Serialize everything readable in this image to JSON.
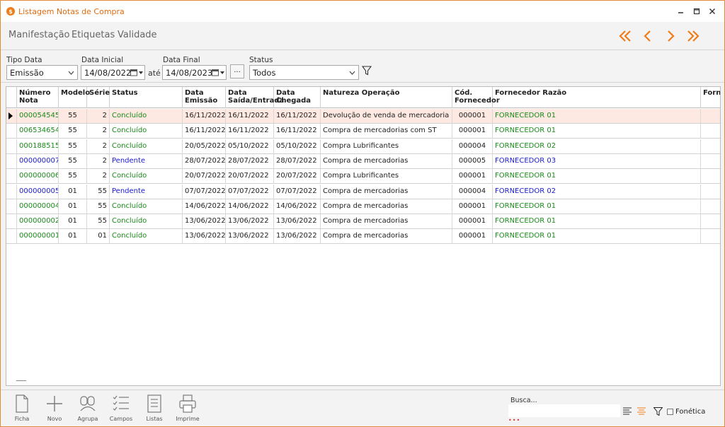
{
  "window": {
    "title": "Listagem Notas de Compra"
  },
  "menu": [
    "Manifestação",
    "Etiquetas",
    "Validade"
  ],
  "filters": {
    "tipo_data_label": "Tipo Data",
    "tipo_data_value": "Emissão",
    "data_inicial_label": "Data Inicial",
    "data_inicial_value": "14/08/2022",
    "ate_label": "até",
    "data_final_label": "Data Final",
    "data_final_value": "14/08/2023",
    "dots_label": "...",
    "status_label": "Status",
    "status_value": "Todos"
  },
  "grid": {
    "headers": [
      "Número Nota",
      "Modelo",
      "Série",
      "Status",
      "Data Emissão",
      "Data Saída/Entrada",
      "Data Chegada",
      "Natureza Operação",
      "Cód. Fornecedor",
      "Fornecedor Razão",
      "Forne"
    ],
    "rows": [
      {
        "numero": "000054545",
        "modelo": "55",
        "serie": "2",
        "status": "Concluído",
        "emissao": "16/11/2022",
        "saida": "16/11/2022",
        "chegada": "16/11/2022",
        "natureza": "Devolução de venda de mercadoria",
        "cod": "000001",
        "razao": "FORNECEDOR 01",
        "color": "green",
        "selected": true
      },
      {
        "numero": "006534654",
        "modelo": "55",
        "serie": "2",
        "status": "Concluído",
        "emissao": "16/11/2022",
        "saida": "16/11/2022",
        "chegada": "16/11/2022",
        "natureza": "Compra de mercadorias com ST",
        "cod": "000001",
        "razao": "FORNECEDOR 01",
        "color": "green"
      },
      {
        "numero": "000188515",
        "modelo": "55",
        "serie": "2",
        "status": "Concluído",
        "emissao": "20/05/2022",
        "saida": "05/10/2022",
        "chegada": "05/10/2022",
        "natureza": "Compra Lubrificantes",
        "cod": "000004",
        "razao": "FORNECEDOR 02",
        "color": "green"
      },
      {
        "numero": "000000007",
        "modelo": "55",
        "serie": "2",
        "status": "Pendente",
        "emissao": "28/07/2022",
        "saida": "28/07/2022",
        "chegada": "28/07/2022",
        "natureza": "Compra de mercadorias",
        "cod": "000005",
        "razao": "FORNECEDOR 03",
        "color": "blue"
      },
      {
        "numero": "000000006",
        "modelo": "55",
        "serie": "2",
        "status": "Concluído",
        "emissao": "20/07/2022",
        "saida": "20/07/2022",
        "chegada": "20/07/2022",
        "natureza": "Compra Lubrificantes",
        "cod": "000001",
        "razao": "FORNECEDOR 01",
        "color": "green"
      },
      {
        "numero": "000000005",
        "modelo": "01",
        "serie": "55",
        "status": "Pendente",
        "emissao": "07/07/2022",
        "saida": "07/07/2022",
        "chegada": "07/07/2022",
        "natureza": "Compra de mercadorias",
        "cod": "000004",
        "razao": "FORNECEDOR 02",
        "color": "blue"
      },
      {
        "numero": "000000004",
        "modelo": "01",
        "serie": "55",
        "status": "Concluído",
        "emissao": "14/06/2022",
        "saida": "14/06/2022",
        "chegada": "14/06/2022",
        "natureza": "Compra de mercadorias",
        "cod": "000001",
        "razao": "FORNECEDOR 01",
        "color": "green"
      },
      {
        "numero": "000000002",
        "modelo": "01",
        "serie": "55",
        "status": "Concluído",
        "emissao": "13/06/2022",
        "saida": "13/06/2022",
        "chegada": "13/06/2022",
        "natureza": "Compra de mercadorias",
        "cod": "000001",
        "razao": "FORNECEDOR 01",
        "color": "green"
      },
      {
        "numero": "000000001",
        "modelo": "01",
        "serie": "01",
        "status": "Concluído",
        "emissao": "13/06/2022",
        "saida": "13/06/2022",
        "chegada": "13/06/2022",
        "natureza": "Compra de mercadorias",
        "cod": "000001",
        "razao": "FORNECEDOR 01",
        "color": "green"
      }
    ]
  },
  "toolbar": {
    "buttons": [
      "Ficha",
      "Novo",
      "Agrupa",
      "Campos",
      "Listas",
      "Imprime"
    ],
    "busca_label": "Busca...",
    "busca_value": "",
    "fonetica_label": "Fonética"
  },
  "colors": {
    "accent": "#f07c19",
    "green": "#1a8a1a",
    "blue": "#1a1ad0",
    "selected_row": "#fde9e1"
  }
}
